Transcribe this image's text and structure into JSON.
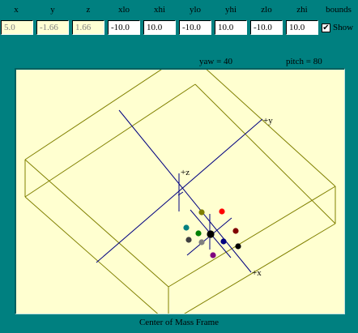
{
  "controls": {
    "headers": [
      "x",
      "y",
      "z",
      "xlo",
      "xhi",
      "ylo",
      "yhi",
      "zlo",
      "zhi",
      "bounds"
    ],
    "values": [
      "5.0",
      "-1.66",
      "1.66",
      "-10.0",
      "10.0",
      "-10.0",
      "10.0",
      "-10.0",
      "10.0"
    ],
    "show_label": "Show",
    "show_checked": true
  },
  "view": {
    "yaw_label": "yaw = 40",
    "pitch_label": "pitch = 80"
  },
  "axes": {
    "x_label": "+x",
    "y_label": "+y",
    "z_label": "+z"
  },
  "particle_colors": [
    "#808000",
    "#ff0000",
    "#008080",
    "#008000",
    "#000000",
    "#800000",
    "#404040",
    "#808080",
    "#000080",
    "#000000",
    "#800080"
  ],
  "colors": {
    "background": "#008080",
    "canvas": "#ffffd0",
    "box_edges": "#808000",
    "axes": "#000080"
  },
  "caption": "Center of Mass Frame"
}
